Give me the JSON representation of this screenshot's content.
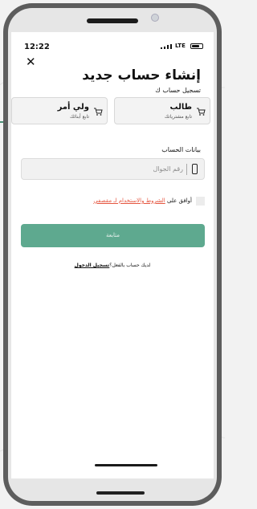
{
  "status_bar": {
    "time": "12:22",
    "network": "LTE"
  },
  "header": {
    "close": "✕",
    "title": "إنشاء حساب جديد",
    "subtitle": "تسجيل حساب ك"
  },
  "account_types": [
    {
      "title": "طالب",
      "subtitle": "تابع مشترياتك",
      "icon": "cart-icon"
    },
    {
      "title": "ولي أمر",
      "subtitle": "تابع أبنائك",
      "icon": "cart-icon"
    }
  ],
  "account_section": {
    "label": "بيانات الحساب",
    "phone_placeholder": "رقم الجوال"
  },
  "terms": {
    "prefix": "أوافق على",
    "link": "الشروط والاستخدام لـ مقصفي"
  },
  "submit": {
    "label": "متابعة"
  },
  "login": {
    "prefix": "لديك حساب بالفعل؟",
    "link": "تسجيل الدخول"
  },
  "colors": {
    "primary": "#5ea98f",
    "link": "#e5553f"
  }
}
